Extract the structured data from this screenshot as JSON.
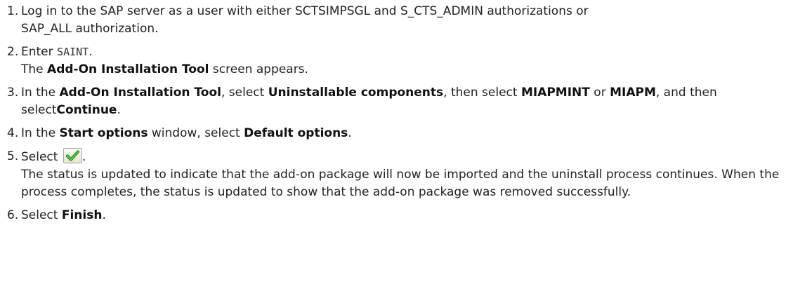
{
  "steps": [
    {
      "num": "1.",
      "line1": "Log in to the SAP server as a user with either SCTSIMPSGL and S_CTS_ADMIN authorizations or",
      "line2": "SAP_ALL authorization."
    },
    {
      "num": "2.",
      "enter": "Enter ",
      "code": "SAINT",
      "period": ".",
      "result_pre": "The ",
      "result_bold": "Add-On Installation Tool",
      "result_post": " screen appears."
    },
    {
      "num": "3.",
      "t1": "In the ",
      "b1": "Add-On Installation Tool",
      "t2": ", select ",
      "b2": "Uninstallable components",
      "t3": ", then select ",
      "b3": "MIAPMINT",
      "t4": " or ",
      "b4": "MIAPM",
      "t5": ", and then select",
      "b5": "Continue",
      "t6": "."
    },
    {
      "num": "4.",
      "t1": "In the ",
      "b1": "Start options",
      "t2": " window, select ",
      "b2": "Default options",
      "t3": "."
    },
    {
      "num": "5.",
      "t1": "Select ",
      "icon": "green-checkmark-icon",
      "t2": ".",
      "desc": "The status is updated to indicate that the add-on package will now be imported and the uninstall process continues. When the process completes, the status is updated to show that the add-on package was removed successfully."
    },
    {
      "num": "6.",
      "t1": "Select ",
      "b1": "Finish",
      "t2": "."
    }
  ],
  "colors": {
    "check_green": "#2e9e2e",
    "text": "#222222"
  }
}
